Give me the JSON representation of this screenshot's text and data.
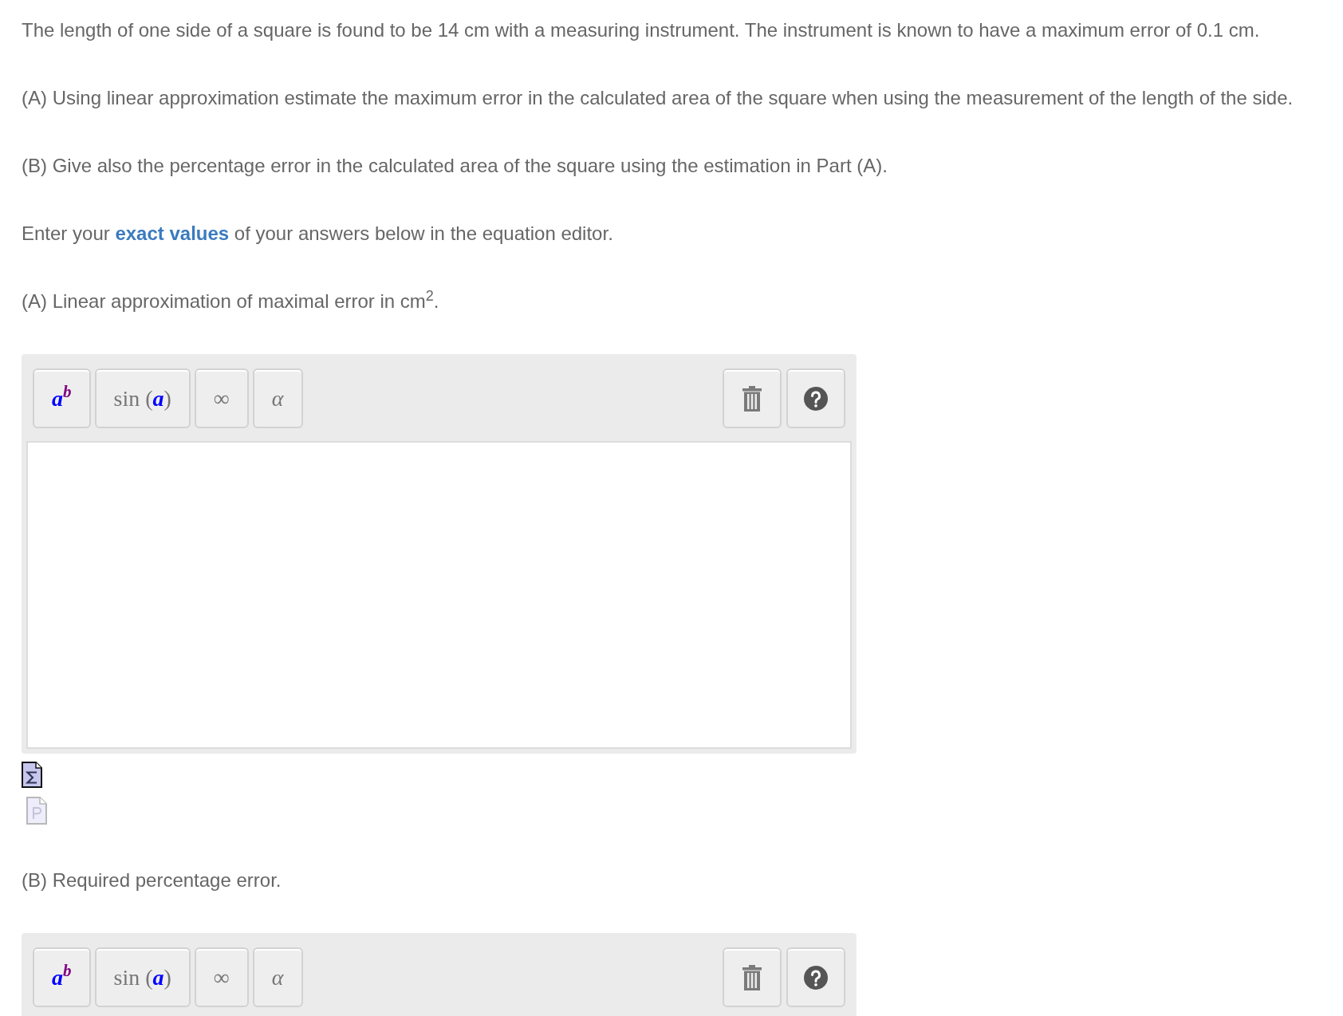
{
  "content": [
    {
      "kind": "text",
      "text": "The length of one side of a square is found to be 14 cm with a measuring instrument. The instrument is known to have a maximum error of 0.1 cm."
    },
    {
      "kind": "text",
      "text": "(A) Using linear approximation estimate the maximum error in the calculated area of the square when using the measurement of the length of the side."
    },
    {
      "kind": "text",
      "text": "(B) Give also the percentage error in the calculated area of the square using the estimation in Part (A)."
    },
    {
      "kind": "text",
      "text": "Enter your **exact values** of your answers below in the equation editor."
    },
    {
      "kind": "text",
      "text": "(A) Linear approximation of maximal error in cm$^{2}$."
    },
    {
      "kind": "toolbar",
      "buttons": [
        "**a**$^{b}$",
        "sin (**a**)",
        "∞",
        "*α*"
      ]
    },
    {
      "kind": "answer_box"
    },
    {
      "kind": "file_icons"
    },
    {
      "kind": "text",
      "text": "(B) Required percentage error."
    },
    {
      "kind": "toolbar",
      "buttons": [
        "**a**$^{b}$",
        "sin (**a**)",
        "∞",
        "*α*"
      ]
    }
  ]
}
